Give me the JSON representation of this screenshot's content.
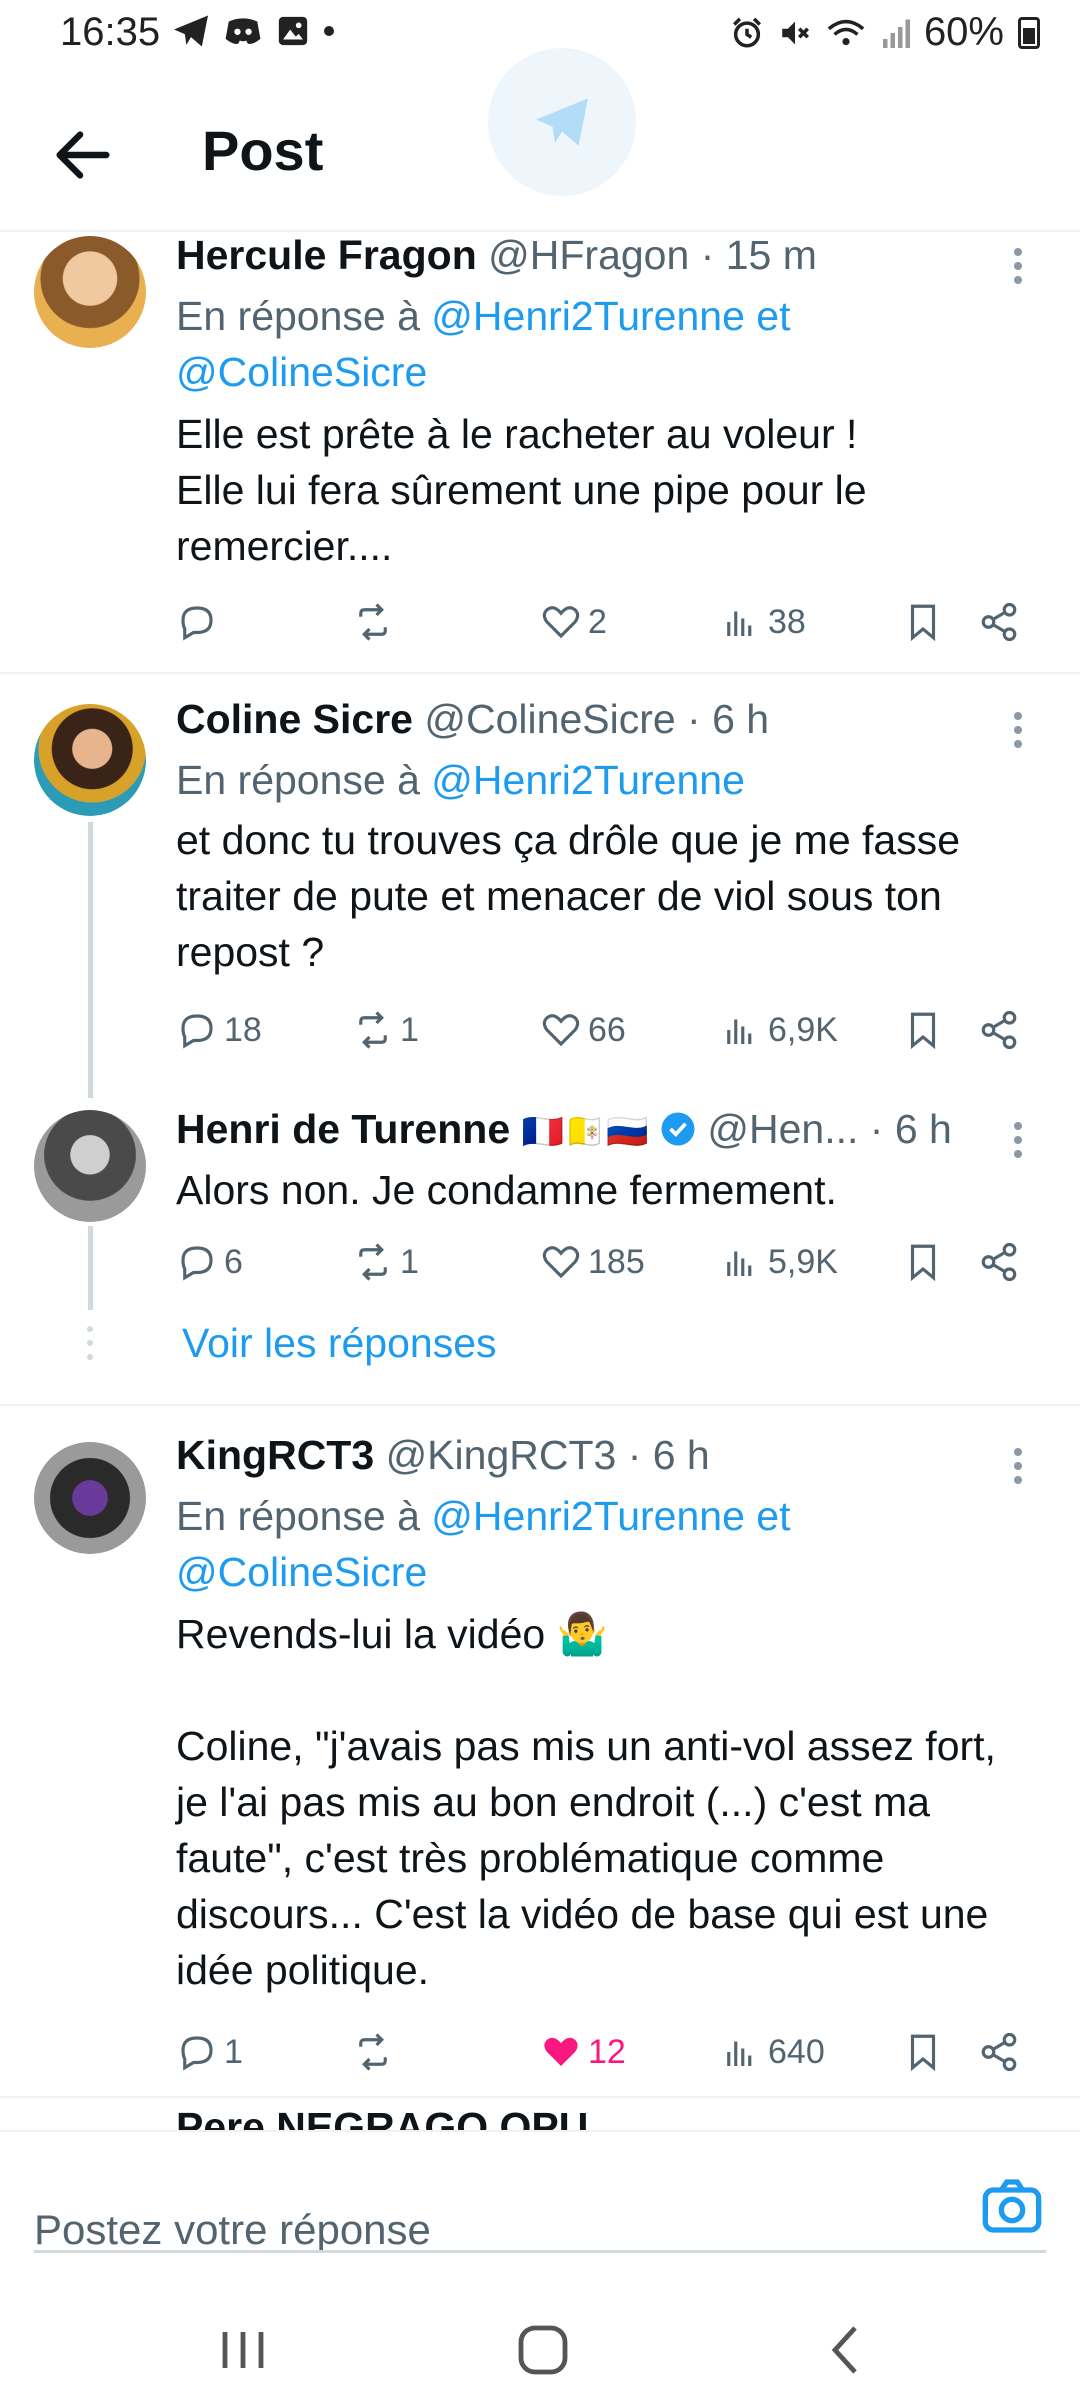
{
  "status_bar": {
    "time": "16:35",
    "battery": "60%",
    "left_icons": [
      "telegram-icon",
      "discord-icon",
      "gallery-icon"
    ],
    "right_icons": [
      "alarm-icon",
      "mute-icon",
      "wifi-icon",
      "signal-icon"
    ]
  },
  "header": {
    "title": "Post",
    "back_icon": "arrow-left-icon"
  },
  "tweets": [
    {
      "name": "Hercule Fragon",
      "handle_time": "@HFragon · 15 m",
      "reply_prefix": "En réponse à ",
      "reply_line1": "@Henri2Turenne et",
      "reply_line2": "@ColineSicre",
      "text": "Elle est prête à le racheter au voleur !\nElle lui fera sûrement une pipe pour le\nremercier....",
      "reply_count": "",
      "repost_count": "",
      "like_count": "2",
      "view_count": "38"
    },
    {
      "name": "Coline Sicre",
      "handle_time": "@ColineSicre · 6 h",
      "reply_prefix": "En réponse à ",
      "reply_line1": "@Henri2Turenne",
      "text": "et donc tu trouves ça drôle que je me fasse\ntraiter de pute et menacer de viol sous ton\nrepost ?",
      "reply_count": "18",
      "repost_count": "1",
      "like_count": "66",
      "view_count": "6,9K"
    },
    {
      "name": "Henri de Turenne",
      "flags": "🇫🇷🇻🇦🇷🇺",
      "handle": "@Hen...",
      "time": "· 6 h",
      "text": "Alors non. Je condamne fermement.",
      "reply_count": "6",
      "repost_count": "1",
      "like_count": "185",
      "view_count": "5,9K"
    },
    {
      "name": "KingRCT3",
      "handle_time": "@KingRCT3 · 6 h",
      "reply_prefix": "En réponse à ",
      "reply_line1": "@Henri2Turenne et",
      "reply_line2": "@ColineSicre",
      "text": "Revends-lui la vidéo 🤷‍♂️\n\nColine, \"j'avais pas mis un anti-vol assez fort,\nje l'ai pas mis au bon endroit (...) c'est ma\nfaute\", c'est très problématique comme\ndiscours... C'est la vidéo de base qui est une\nidée politique.",
      "reply_count": "1",
      "repost_count": "",
      "like_count": "12",
      "view_count": "640"
    }
  ],
  "voir_reponses": "Voir les réponses",
  "partial_next": "Pere NEGRAGO OPU",
  "reply_bar": {
    "placeholder": "Postez votre réponse"
  },
  "colors": {
    "link": "#1d9bf0",
    "muted": "#536471",
    "like_active": "#f91880"
  }
}
